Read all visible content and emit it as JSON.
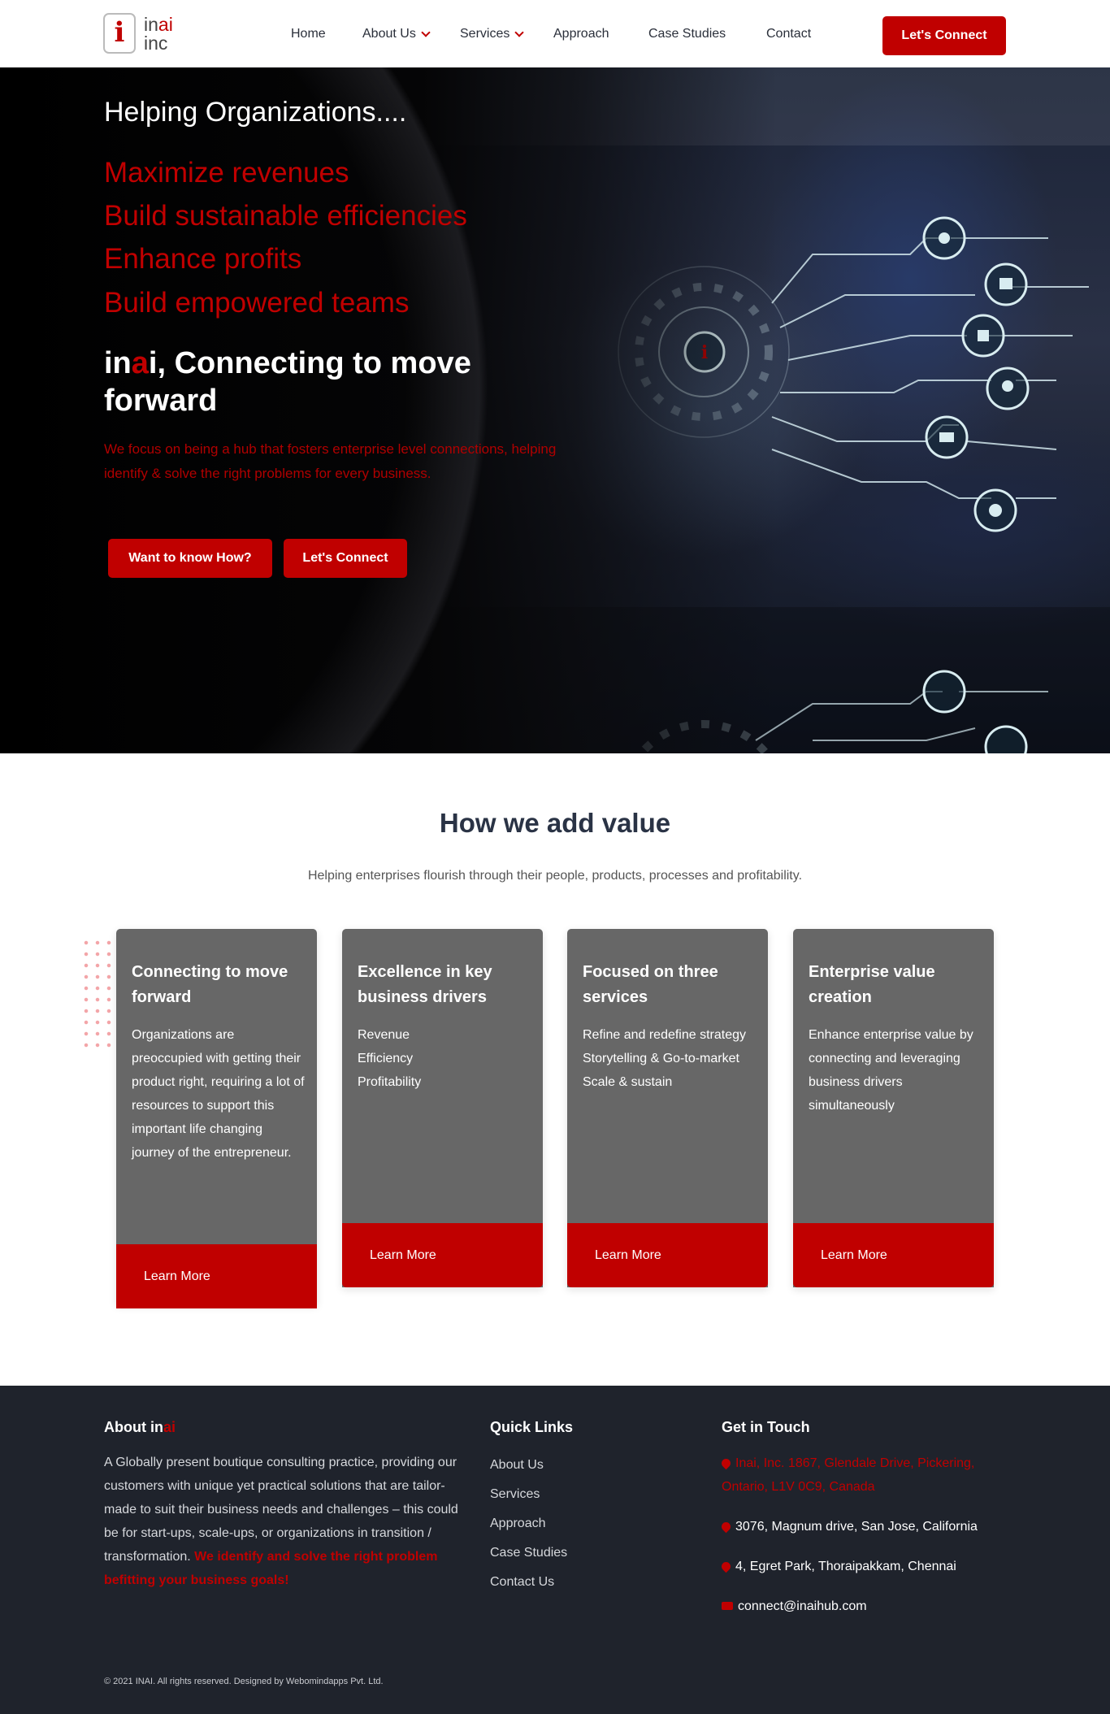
{
  "brand": {
    "logo_mark": "i",
    "logo_line1_a": "in",
    "logo_line1_b": "ai",
    "logo_line2": "inc"
  },
  "nav": {
    "home": "Home",
    "about": "About Us",
    "services": "Services",
    "approach": "Approach",
    "case_studies": "Case Studies",
    "contact": "Contact",
    "cta": "Let's Connect"
  },
  "hero": {
    "intro": "Helping Organizations....",
    "lines": [
      "Maximize revenues",
      "Build sustainable efficiencies",
      "Enhance profits",
      "Build empowered teams"
    ],
    "title_a": "in",
    "title_b": "a",
    "title_c": "i, Connecting to move forward",
    "desc": "We focus on being a hub that fosters enterprise level connections, helping identify & solve the right problems for every business.",
    "btn_how": "Want to know How?",
    "btn_connect": "Let's Connect"
  },
  "value": {
    "title": "How we add value",
    "subtitle": "Helping enterprises flourish through their people, products, processes and profitability.",
    "cards": [
      {
        "title": "Connecting to move forward",
        "text": "Organizations are preoccupied with getting their product right, requiring a lot of resources to support this important life changing journey of the entrepreneur.",
        "cta": "Learn More"
      },
      {
        "title": "Excellence in key business drivers",
        "text": "Revenue\nEfficiency\nProfitability",
        "cta": "Learn More"
      },
      {
        "title": "Focused on three services",
        "text": "Refine and redefine strategy\nStorytelling & Go-to-market\nScale & sustain",
        "cta": "Learn More"
      },
      {
        "title": "Enterprise value creation",
        "text": "Enhance enterprise value by connecting and leveraging business drivers simultaneously",
        "cta": "Learn More"
      }
    ]
  },
  "footer": {
    "about_title_a": "About in",
    "about_title_b": "ai",
    "about_text": "A Globally present boutique consulting practice, providing our customers with unique yet practical solutions that are tailor-made to suit their business needs and challenges – this could be for start-ups, scale-ups, or organizations in transition / transformation. ",
    "about_highlight": "We identify and solve the right problem befitting your business goals!",
    "links_title": "Quick Links",
    "links": [
      "About Us",
      "Services",
      "Approach",
      "Case Studies",
      "Contact Us"
    ],
    "contact_title": "Get in Touch",
    "address1": "Inai, Inc. 1867, Glendale Drive, Pickering, Ontario, L1V 0C9, Canada",
    "address2": "3076, Magnum drive, San Jose, California",
    "address3": "4, Egret Park, Thoraipakkam, Chennai",
    "email": "connect@inaihub.com",
    "copyright": "© 2021 INAI. All rights reserved. Designed by Webomindapps Pvt. Ltd."
  },
  "colors": {
    "accent": "#c00000",
    "footer_bg": "#1f232c",
    "card_bg": "#676767"
  }
}
